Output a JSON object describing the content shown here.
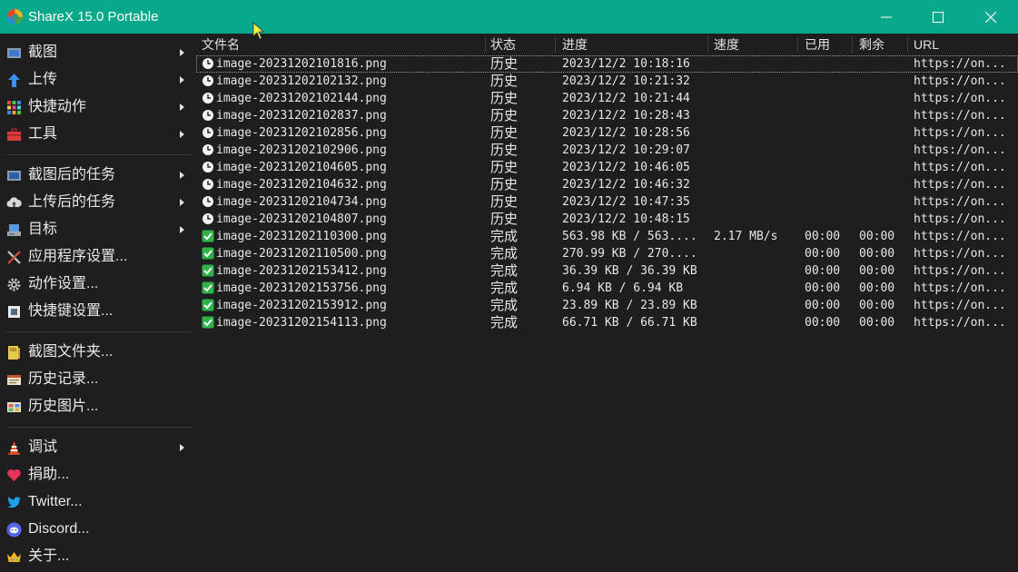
{
  "window": {
    "title": "ShareX 15.0 Portable",
    "accent_color": "#07a88b"
  },
  "sidebar": {
    "items": [
      {
        "label": "截图",
        "icon": "capture-icon",
        "submenu": true
      },
      {
        "label": "上传",
        "icon": "upload-arrow-icon",
        "submenu": true
      },
      {
        "label": "快捷动作",
        "icon": "workflow-grid-icon",
        "submenu": true
      },
      {
        "label": "工具",
        "icon": "toolbox-icon",
        "submenu": true
      },
      {
        "label": "截图后的任务",
        "icon": "after-capture-icon",
        "submenu": true
      },
      {
        "label": "上传后的任务",
        "icon": "cloud-upload-icon",
        "submenu": true
      },
      {
        "label": "目标",
        "icon": "destination-icon",
        "submenu": true
      },
      {
        "label": "应用程序设置...",
        "icon": "wrench-screwdriver-icon",
        "submenu": false
      },
      {
        "label": "动作设置...",
        "icon": "gear-icon",
        "submenu": false
      },
      {
        "label": "快捷键设置...",
        "icon": "keyboard-icon",
        "submenu": false
      },
      {
        "label": "截图文件夹...",
        "icon": "folder-icon",
        "submenu": false
      },
      {
        "label": "历史记录...",
        "icon": "history-icon",
        "submenu": false
      },
      {
        "label": "历史图片...",
        "icon": "image-history-icon",
        "submenu": false
      },
      {
        "label": "调试",
        "icon": "traffic-cone-icon",
        "submenu": true
      },
      {
        "label": "捐助...",
        "icon": "heart-icon",
        "submenu": false
      },
      {
        "label": "Twitter...",
        "icon": "twitter-icon",
        "submenu": false
      },
      {
        "label": "Discord...",
        "icon": "discord-icon",
        "submenu": false
      },
      {
        "label": "关于...",
        "icon": "crown-icon",
        "submenu": false
      }
    ]
  },
  "list": {
    "columns": [
      "文件名",
      "状态",
      "进度",
      "速度",
      "已用",
      "剩余",
      "URL"
    ],
    "rows": [
      {
        "file": "image-20231202101816.png",
        "status": "历史",
        "progress": "2023/12/2 10:18:16",
        "speed": "",
        "elapsed": "",
        "remaining": "",
        "url": "https://on...",
        "icon": "clock-icon"
      },
      {
        "file": "image-20231202102132.png",
        "status": "历史",
        "progress": "2023/12/2 10:21:32",
        "speed": "",
        "elapsed": "",
        "remaining": "",
        "url": "https://on...",
        "icon": "clock-icon"
      },
      {
        "file": "image-20231202102144.png",
        "status": "历史",
        "progress": "2023/12/2 10:21:44",
        "speed": "",
        "elapsed": "",
        "remaining": "",
        "url": "https://on...",
        "icon": "clock-icon"
      },
      {
        "file": "image-20231202102837.png",
        "status": "历史",
        "progress": "2023/12/2 10:28:43",
        "speed": "",
        "elapsed": "",
        "remaining": "",
        "url": "https://on...",
        "icon": "clock-icon"
      },
      {
        "file": "image-20231202102856.png",
        "status": "历史",
        "progress": "2023/12/2 10:28:56",
        "speed": "",
        "elapsed": "",
        "remaining": "",
        "url": "https://on...",
        "icon": "clock-icon"
      },
      {
        "file": "image-20231202102906.png",
        "status": "历史",
        "progress": "2023/12/2 10:29:07",
        "speed": "",
        "elapsed": "",
        "remaining": "",
        "url": "https://on...",
        "icon": "clock-icon"
      },
      {
        "file": "image-20231202104605.png",
        "status": "历史",
        "progress": "2023/12/2 10:46:05",
        "speed": "",
        "elapsed": "",
        "remaining": "",
        "url": "https://on...",
        "icon": "clock-icon"
      },
      {
        "file": "image-20231202104632.png",
        "status": "历史",
        "progress": "2023/12/2 10:46:32",
        "speed": "",
        "elapsed": "",
        "remaining": "",
        "url": "https://on...",
        "icon": "clock-icon"
      },
      {
        "file": "image-20231202104734.png",
        "status": "历史",
        "progress": "2023/12/2 10:47:35",
        "speed": "",
        "elapsed": "",
        "remaining": "",
        "url": "https://on...",
        "icon": "clock-icon"
      },
      {
        "file": "image-20231202104807.png",
        "status": "历史",
        "progress": "2023/12/2 10:48:15",
        "speed": "",
        "elapsed": "",
        "remaining": "",
        "url": "https://on...",
        "icon": "clock-icon"
      },
      {
        "file": "image-20231202110300.png",
        "status": "完成",
        "progress": "563.98 KB / 563....",
        "speed": "2.17 MB/s",
        "elapsed": "00:00",
        "remaining": "00:00",
        "url": "https://on...",
        "icon": "check-icon"
      },
      {
        "file": "image-20231202110500.png",
        "status": "完成",
        "progress": "270.99 KB / 270....",
        "speed": "",
        "elapsed": "00:00",
        "remaining": "00:00",
        "url": "https://on...",
        "icon": "check-icon"
      },
      {
        "file": "image-20231202153412.png",
        "status": "完成",
        "progress": "36.39 KB / 36.39 KB",
        "speed": "",
        "elapsed": "00:00",
        "remaining": "00:00",
        "url": "https://on...",
        "icon": "check-icon"
      },
      {
        "file": "image-20231202153756.png",
        "status": "完成",
        "progress": "6.94 KB / 6.94 KB",
        "speed": "",
        "elapsed": "00:00",
        "remaining": "00:00",
        "url": "https://on...",
        "icon": "check-icon"
      },
      {
        "file": "image-20231202153912.png",
        "status": "完成",
        "progress": "23.89 KB / 23.89 KB",
        "speed": "",
        "elapsed": "00:00",
        "remaining": "00:00",
        "url": "https://on...",
        "icon": "check-icon"
      },
      {
        "file": "image-20231202154113.png",
        "status": "完成",
        "progress": "66.71 KB / 66.71 KB",
        "speed": "",
        "elapsed": "00:00",
        "remaining": "00:00",
        "url": "https://on...",
        "icon": "check-icon"
      }
    ]
  }
}
